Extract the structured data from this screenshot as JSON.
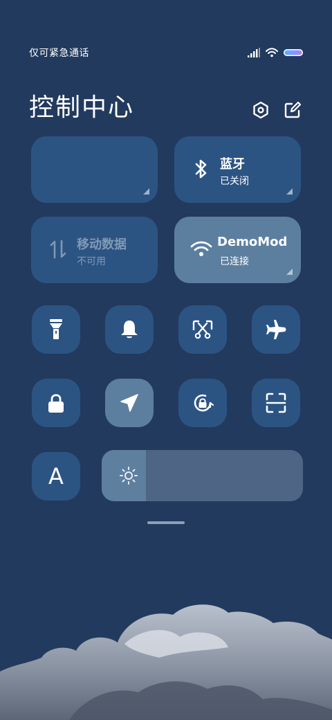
{
  "status_bar": {
    "carrier_text": "仅可紧急通话",
    "battery_gradient": [
      "#52b4ff",
      "#b77bff"
    ]
  },
  "header": {
    "title": "控制中心",
    "settings_icon": "hexagon-gear-icon",
    "edit_icon": "edit-icon"
  },
  "tiles": {
    "blank": {
      "label": ""
    },
    "bluetooth": {
      "label": "蓝牙",
      "status": "已关闭",
      "icon": "bluetooth-icon"
    },
    "mobile_data": {
      "label": "移动数据",
      "status": "不可用",
      "icon": "data-arrows-icon"
    },
    "wifi": {
      "label": "DemoMod",
      "status": "已连接",
      "icon": "wifi-icon"
    }
  },
  "toggles": [
    {
      "name": "flashlight",
      "icon": "flashlight-icon",
      "active": false
    },
    {
      "name": "ring",
      "icon": "bell-icon",
      "active": false
    },
    {
      "name": "screenshot",
      "icon": "scissors-icon",
      "active": false
    },
    {
      "name": "airplane",
      "icon": "airplane-icon",
      "active": false
    },
    {
      "name": "lock",
      "icon": "lock-icon",
      "active": false
    },
    {
      "name": "location",
      "icon": "location-arrow-icon",
      "active": true
    },
    {
      "name": "rotation-lock",
      "icon": "rotation-lock-icon",
      "active": false
    },
    {
      "name": "scan",
      "icon": "scan-icon",
      "active": false
    },
    {
      "name": "font",
      "icon": "font-a-icon",
      "label": "A",
      "active": false
    }
  ],
  "brightness": {
    "level": 0.22,
    "icon": "sun-icon"
  },
  "colors": {
    "background": "#223a5e",
    "tile": "#2c5483",
    "tile_active": "#5c7fa0"
  }
}
